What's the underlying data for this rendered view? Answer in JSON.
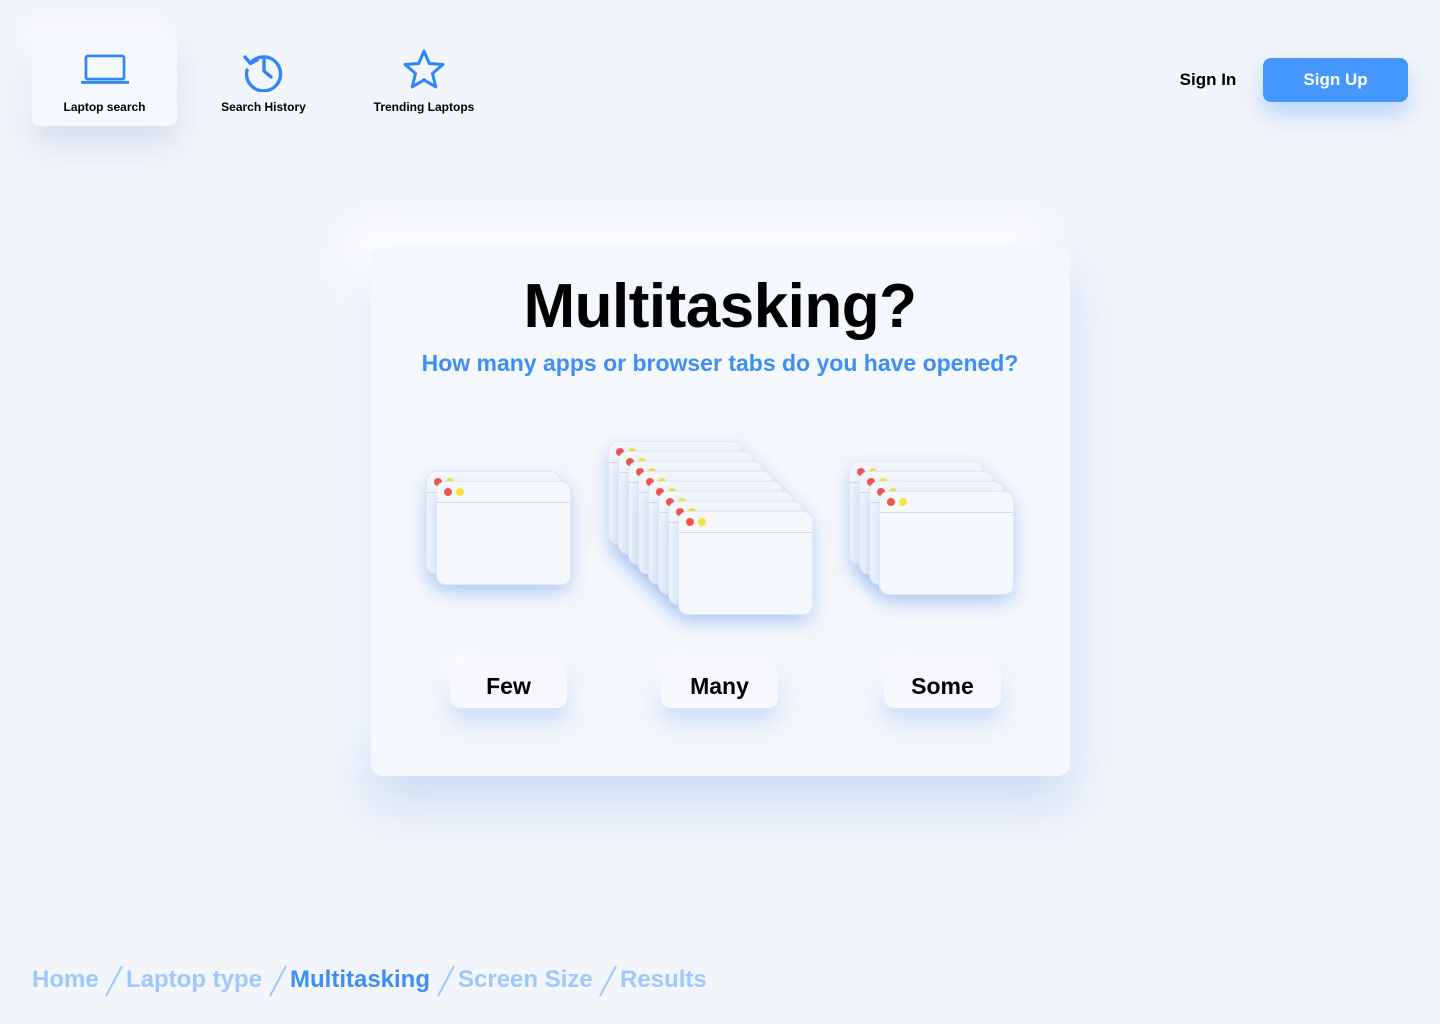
{
  "nav": {
    "items": [
      {
        "label": "Laptop search",
        "icon": "laptop-icon",
        "active": true
      },
      {
        "label": "Search History",
        "icon": "history-icon",
        "active": false
      },
      {
        "label": "Trending Laptops",
        "icon": "star-icon",
        "active": false
      }
    ],
    "sign_in": "Sign In",
    "sign_up": "Sign Up"
  },
  "question": {
    "title": "Multitasking?",
    "subtitle": "How many apps or browser tabs do you have opened?"
  },
  "options": [
    {
      "label": "Few",
      "window_count": 2
    },
    {
      "label": "Many",
      "window_count": 8
    },
    {
      "label": "Some",
      "window_count": 4
    }
  ],
  "breadcrumb": {
    "items": [
      "Home",
      "Laptop type",
      "Multitasking",
      "Screen Size",
      "Results"
    ],
    "current": "Multitasking"
  },
  "colors": {
    "accent": "#4597fb",
    "accent_text": "#3f8ff2",
    "breadcrumb_inactive": "#9fc8fb",
    "background": "#f2f5fa",
    "window_close_dot": "#f0564a",
    "window_minimize_dot": "#f7e33d"
  }
}
